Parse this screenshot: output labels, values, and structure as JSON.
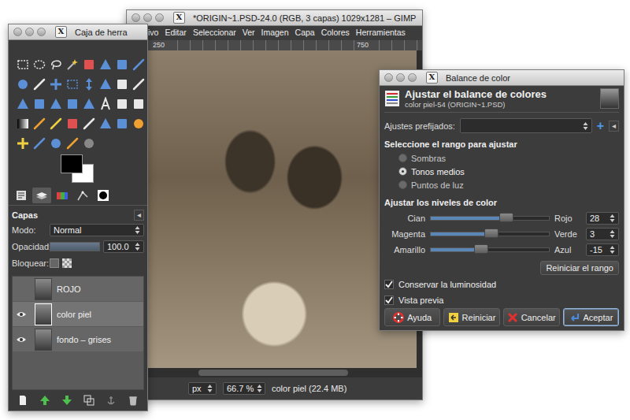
{
  "toolbox": {
    "title": "Caja de herra",
    "badge": "X",
    "tabs": [
      {
        "selected": false
      },
      {
        "selected": true
      },
      {
        "selected": false
      },
      {
        "selected": false
      },
      {
        "selected": false
      }
    ],
    "layers_panel": {
      "title": "Capas",
      "menu_button": "◂",
      "mode_label": "Modo:",
      "mode": "Normal",
      "opacity_label": "Opacidad:",
      "opacity": "100.0",
      "opacity_level": 1.0,
      "lock_label": "Bloquear:",
      "layers": [
        {
          "name": "ROJO",
          "visible": false,
          "selected": false
        },
        {
          "name": "color piel",
          "visible": true,
          "selected": true
        },
        {
          "name": "fondo – grises",
          "visible": true,
          "selected": false
        }
      ]
    }
  },
  "image_window": {
    "title": "*ORIGIN~1.PSD-24.0 (RGB, 3 capas) 1029x1281 – GIMP",
    "badge": "X",
    "menu": [
      "ivo",
      "Editar",
      "Seleccionar",
      "Ver",
      "Imagen",
      "Capa",
      "Colores",
      "Herramientas"
    ],
    "ruler": [
      "250",
      "750"
    ],
    "scrollbar": {
      "level": 0.6
    },
    "unit": "px",
    "zoom": "66.7 %",
    "status": "color piel (22.4 MB)"
  },
  "color_balance": {
    "title": "Balance de color",
    "badge": "X",
    "heading": "Ajustar el balance de colores",
    "subheading": "color piel-54 (ORIGIN~1.PSD)",
    "presets_label": "Ajustes prefijados:",
    "add_button": "+",
    "menu_button": "◂",
    "range_label": "Seleccione el rango para ajustar",
    "ranges": [
      {
        "label": "Sombras",
        "selected": false
      },
      {
        "label": "Tonos medios",
        "selected": true
      },
      {
        "label": "Puntos de luz",
        "selected": false
      }
    ],
    "levels_label": "Ajustar los niveles de color",
    "sliders": [
      {
        "left": "Cian",
        "right": "Rojo",
        "value": "28",
        "level": 0.64
      },
      {
        "left": "Magenta",
        "right": "Verde",
        "value": "3",
        "level": 0.515
      },
      {
        "left": "Amarillo",
        "right": "Azul",
        "value": "-15",
        "level": 0.425
      }
    ],
    "reset_range": "Reiniciar el rango",
    "options": [
      {
        "label": "Conservar la luminosidad",
        "checked": true
      },
      {
        "label": "Vista previa",
        "checked": true
      }
    ],
    "buttons": [
      {
        "label": "Ayuda",
        "kind": "help",
        "default": false
      },
      {
        "label": "Reiniciar",
        "kind": "reset",
        "default": false
      },
      {
        "label": "Cancelar",
        "kind": "cancel",
        "default": false
      },
      {
        "label": "Aceptar",
        "kind": "ok",
        "default": true
      }
    ]
  }
}
